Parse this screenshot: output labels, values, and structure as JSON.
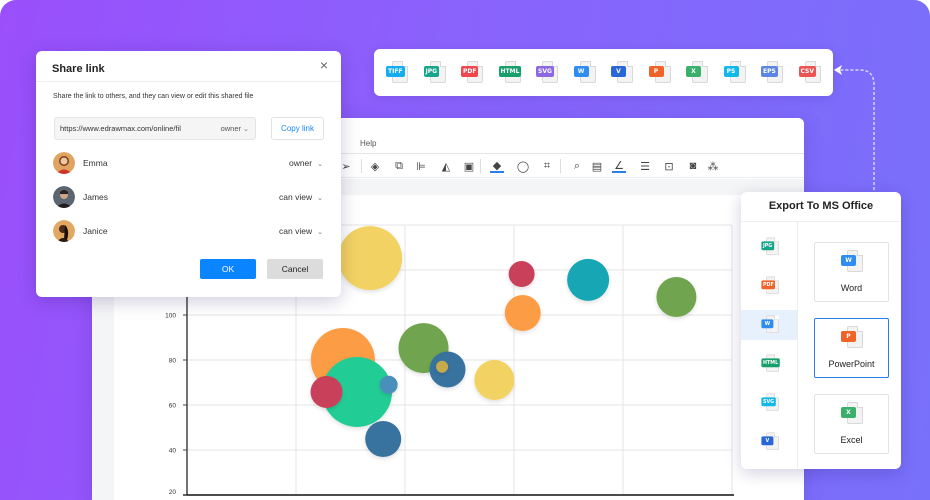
{
  "colors": {
    "accent": "#0a84ff",
    "link": "#1a8bf0",
    "bg_gradient_start": "#9a4ffb",
    "bg_gradient_end": "#7870fb"
  },
  "format_bar": {
    "items": [
      {
        "label": "TIFF",
        "color": "#14aef0"
      },
      {
        "label": "JPG",
        "color": "#16a58b"
      },
      {
        "label": "PDF",
        "color": "#f0474e"
      },
      {
        "label": "HTML",
        "color": "#17a06b"
      },
      {
        "label": "SVG",
        "color": "#8c69e0"
      },
      {
        "label": "W",
        "color": "#2f8cf0"
      },
      {
        "label": "V",
        "color": "#2a66d8"
      },
      {
        "label": "P",
        "color": "#f0642a"
      },
      {
        "label": "X",
        "color": "#3bb06a"
      },
      {
        "label": "PS",
        "color": "#13b7e8"
      },
      {
        "label": "EPS",
        "color": "#5d86e3"
      },
      {
        "label": "CSV",
        "color": "#ec5454"
      }
    ]
  },
  "editor": {
    "menu": {
      "help": "Help"
    },
    "toolbar_icons": [
      "rectangle-icon",
      "text-icon",
      "connector-icon",
      "pointer-icon",
      "layers-icon",
      "group-icon",
      "align-icon",
      "flip-icon",
      "container-icon",
      "fill-icon",
      "shape-style-icon",
      "crop-icon",
      "search-icon",
      "preview-icon",
      "line-color-icon",
      "line-style-icon",
      "lock-icon",
      "frame-icon",
      "more-icon"
    ]
  },
  "share_dialog": {
    "title": "Share link",
    "close": "×",
    "description": "Share the link to others, and they can view or edit this shared file",
    "link_url": "https://www.edrawmax.com/online/fil",
    "link_permission": "owner",
    "copy_label": "Copy link",
    "members": [
      {
        "name": "Emma",
        "role": "owner"
      },
      {
        "name": "James",
        "role": "can view"
      },
      {
        "name": "Janice",
        "role": "can view"
      }
    ],
    "ok_label": "OK",
    "cancel_label": "Cancel",
    "chevron": "⌄"
  },
  "export_panel": {
    "title": "Export To MS Office",
    "side_items": [
      {
        "label": "JPG",
        "color": "#16a58b"
      },
      {
        "label": "PDF",
        "color": "#f0642a"
      },
      {
        "label": "W",
        "color": "#2f8cf0",
        "active": true
      },
      {
        "label": "HTML",
        "color": "#17a06b"
      },
      {
        "label": "SVG",
        "color": "#13b7e8"
      },
      {
        "label": "V",
        "color": "#2a66d8"
      }
    ],
    "cards": [
      {
        "label": "Word",
        "tag": "W",
        "color": "#2f8cf0"
      },
      {
        "label": "PowerPoint",
        "tag": "P",
        "color": "#f0642a",
        "selected": true
      },
      {
        "label": "Excel",
        "tag": "X",
        "color": "#3bb06a"
      }
    ]
  },
  "chart_data": {
    "type": "scatter",
    "subtype": "bubble",
    "title": "",
    "xlabel": "",
    "ylabel": "",
    "xlim": [
      0,
      5
    ],
    "ylim": [
      20,
      140
    ],
    "y_ticks": [
      20,
      40,
      60,
      80,
      100
    ],
    "y_tick_labels": [
      "20",
      "40",
      "60",
      "80",
      "100"
    ],
    "grid": true,
    "legend": "none",
    "points": [
      {
        "x": 1.68,
        "y": 125.3,
        "size": 32,
        "color": "#f2d262"
      },
      {
        "x": 1.43,
        "y": 80.0,
        "size": 32,
        "color": "#fc9d45"
      },
      {
        "x": 1.56,
        "y": 65.8,
        "size": 35,
        "color": "#22cd95"
      },
      {
        "x": 1.28,
        "y": 65.8,
        "size": 16,
        "color": "#c8405a"
      },
      {
        "x": 1.85,
        "y": 69.0,
        "size": 9,
        "color": "#4a8fbc"
      },
      {
        "x": 1.8,
        "y": 44.9,
        "size": 18,
        "color": "#38729f"
      },
      {
        "x": 2.17,
        "y": 85.3,
        "size": 25,
        "color": "#70a44f"
      },
      {
        "x": 2.39,
        "y": 75.8,
        "size": 18,
        "color": "#38729f"
      },
      {
        "x": 2.34,
        "y": 77.0,
        "size": 6,
        "color": "#c5ab4c"
      },
      {
        "x": 2.82,
        "y": 71.1,
        "size": 20,
        "color": "#f2d262"
      },
      {
        "x": 3.07,
        "y": 118.2,
        "size": 13,
        "color": "#c8405a"
      },
      {
        "x": 3.08,
        "y": 100.9,
        "size": 18,
        "color": "#fc9d45"
      },
      {
        "x": 3.68,
        "y": 115.6,
        "size": 21,
        "color": "#17a6b4"
      },
      {
        "x": 4.49,
        "y": 108.0,
        "size": 20,
        "color": "#70a44f"
      }
    ]
  }
}
